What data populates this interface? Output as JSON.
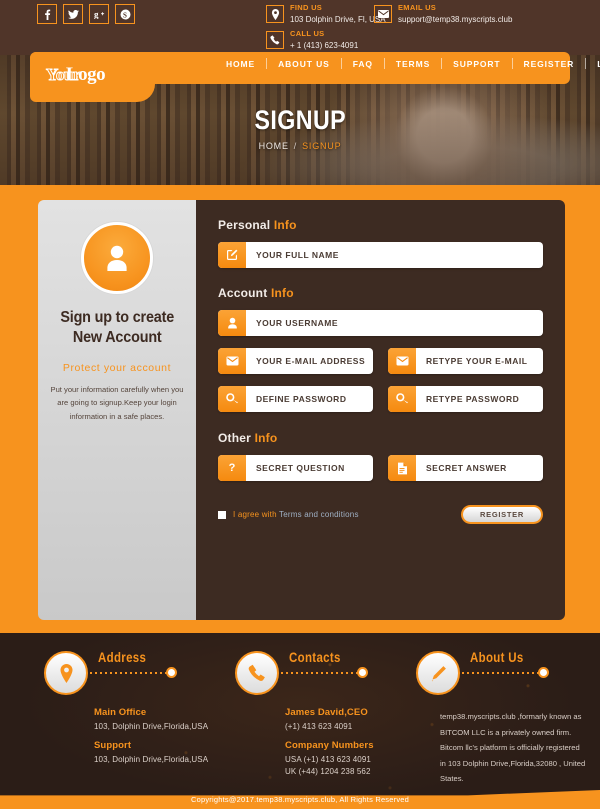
{
  "topbar": {
    "social": [
      {
        "name": "facebook-icon",
        "glyph": "f"
      },
      {
        "name": "twitter-icon",
        "glyph": "t"
      },
      {
        "name": "google-plus-icon",
        "glyph": "g"
      },
      {
        "name": "skype-icon",
        "glyph": "s"
      }
    ],
    "contacts": [
      {
        "icon": "location-pin-icon",
        "label": "FIND US",
        "value": "103 Dolphin Drive, Fl, USA"
      },
      {
        "icon": "envelope-icon",
        "label": "EMAIL US",
        "value": "support@temp38.myscripts.club"
      },
      {
        "icon": "phone-icon",
        "label": "CALL US",
        "value": "+ 1 (413) 623-4091"
      }
    ]
  },
  "nav": {
    "logo_part1": "Your",
    "logo_part2": "Logo",
    "items": [
      {
        "label": "HOME"
      },
      {
        "label": "ABOUT US"
      },
      {
        "label": "FAQ"
      },
      {
        "label": "TERMS"
      },
      {
        "label": "SUPPORT"
      },
      {
        "label": "REGISTER"
      },
      {
        "label": "LOGIN"
      }
    ]
  },
  "hero": {
    "title": "SIGNUP",
    "breadcrumb_home": "HOME",
    "breadcrumb_sep": "/",
    "breadcrumb_current": "SIGNUP"
  },
  "left_panel": {
    "avatar_icon": "user-avatar-icon",
    "heading_line1": "Sign up to create",
    "heading_line2": "New Account",
    "subheading": "Protect your account",
    "body": "Put your information carefully when you are going to signup.Keep your login information in a safe places."
  },
  "form": {
    "sections": [
      {
        "title": "Personal",
        "highlight": "Info"
      },
      {
        "title": "Account",
        "highlight": "Info"
      },
      {
        "title": "Other",
        "highlight": "Info"
      }
    ],
    "fields": {
      "full_name": {
        "icon": "edit-pencil-icon",
        "placeholder": "YOUR FULL NAME"
      },
      "username": {
        "icon": "user-icon",
        "placeholder": "YOUR USERNAME"
      },
      "email": {
        "icon": "envelope-icon",
        "placeholder": "YOUR E-MAIL ADDRESS"
      },
      "retype_email": {
        "icon": "envelope-icon",
        "placeholder": "RETYPE YOUR E-MAIL"
      },
      "password": {
        "icon": "key-icon",
        "placeholder": "DEFINE PASSWORD"
      },
      "retype_password": {
        "icon": "key-icon",
        "placeholder": "RETYPE PASSWORD"
      },
      "secret_question": {
        "icon": "question-mark-icon",
        "placeholder": "SECRET QUESTION"
      },
      "secret_answer": {
        "icon": "document-icon",
        "placeholder": "SECRET ANSWER"
      }
    },
    "agree_prefix": "I agree with ",
    "agree_terms": "Terms and conditions",
    "register_label": "REGISTER"
  },
  "footer": {
    "columns": [
      {
        "icon": "location-pin-icon",
        "title": "Address",
        "strong1": "Main Office",
        "line1": "103, Dolphin Drive,Florida,USA",
        "strong2": "Support",
        "line2": "103, Dolphin Drive,Florida,USA"
      },
      {
        "icon": "phone-icon",
        "title": "Contacts",
        "strong1": "James David,CEO",
        "line1": "(+1) 413 623 4091",
        "strong2": "Company Numbers",
        "line2": "USA (+1) 413 623 4091",
        "line3": "UK (+44) 1204 238 562"
      },
      {
        "icon": "pencil-icon",
        "title": "About Us",
        "about": "temp38.myscripts.club ,formarly known as BITCOM LLC is a privately owned firm. Bitcom llc's platform is officially registered in 103 Dolphin Drive,Florida,32080 , United States."
      }
    ],
    "copyright": "Copyrights@2017.temp38.myscripts.club, All Rights Reserved"
  },
  "colors": {
    "accent": "#f7931e",
    "dark_brown": "#3d2b22",
    "footer_bg": "#2b1d17",
    "topbar_bg": "#503529",
    "panel_gray": "#d5d5d5"
  }
}
